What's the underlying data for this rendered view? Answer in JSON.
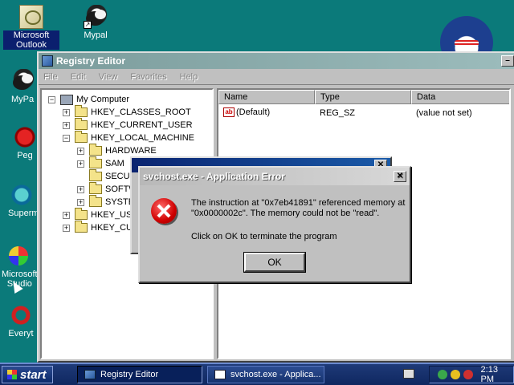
{
  "desktop": {
    "icons": [
      {
        "label": "Microsoft Outlook",
        "icon": "outlook-icon"
      },
      {
        "label": "Mypal",
        "icon": "mypal-icon"
      },
      {
        "label": "MyPa",
        "icon": "mypal-icon"
      },
      {
        "label": "Peg",
        "icon": "red-app-icon"
      },
      {
        "label": "Superm",
        "icon": "teal-app-icon"
      },
      {
        "label": "Microsoft Studio",
        "icon": "studio-icon"
      },
      {
        "label": "Everyt",
        "icon": "everything-icon"
      }
    ]
  },
  "registry": {
    "title": "Registry Editor",
    "menu": [
      "File",
      "Edit",
      "View",
      "Favorites",
      "Help"
    ],
    "tree": [
      {
        "label": "My Computer",
        "expander": "−"
      },
      {
        "label": "HKEY_CLASSES_ROOT",
        "expander": "+"
      },
      {
        "label": "HKEY_CURRENT_USER",
        "expander": "+"
      },
      {
        "label": "HKEY_LOCAL_MACHINE",
        "expander": "−"
      },
      {
        "label": "HARDWARE",
        "expander": "+"
      },
      {
        "label": "SAM",
        "expander": "+"
      },
      {
        "label": "SECURI",
        "expander": ""
      },
      {
        "label": "SOFTW",
        "expander": "+"
      },
      {
        "label": "SYSTE",
        "expander": "+"
      },
      {
        "label": "HKEY_USE",
        "expander": "+"
      },
      {
        "label": "HKEY_CUR",
        "expander": "+"
      }
    ],
    "columns": [
      "Name",
      "Type",
      "Data"
    ],
    "rows": [
      {
        "name": "(Default)",
        "type": "REG_SZ",
        "data": "(value not set)"
      }
    ]
  },
  "error_dialog": {
    "title": "svchost.exe - Application Error",
    "close": "✕",
    "message": "The instruction at \"0x7eb41891\" referenced memory at \"0x0000002c\". The memory could not be \"read\".",
    "instruction": "Click on OK to terminate the program",
    "ok_label": "OK"
  },
  "taskbar": {
    "start_label": "start",
    "items": [
      {
        "label": "Registry Editor",
        "active": true
      },
      {
        "label": "svchost.exe - Applica...",
        "active": false
      }
    ],
    "clock": "2:13 PM"
  },
  "colors": {
    "desktop": "#0b7a7a",
    "taskbar": "#1e3a78",
    "active_title": "#0a2470",
    "error_icon": "#d00000"
  }
}
